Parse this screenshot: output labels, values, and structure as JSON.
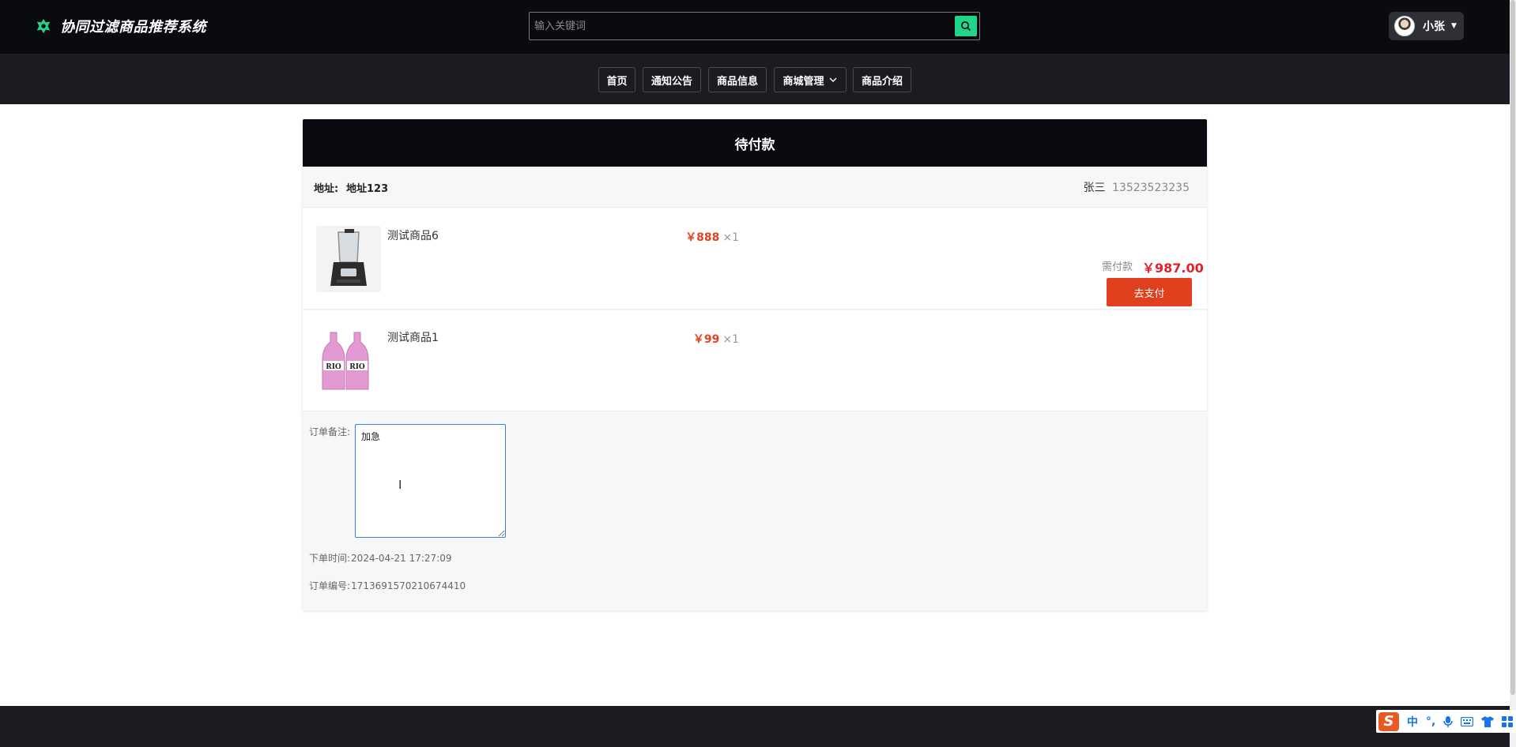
{
  "header": {
    "app_title": "协同过滤商品推荐系统",
    "search_placeholder": "输入关键词",
    "user_name": "小张"
  },
  "nav": {
    "items": [
      {
        "label": "首页"
      },
      {
        "label": "通知公告"
      },
      {
        "label": "商品信息"
      },
      {
        "label": "商城管理"
      },
      {
        "label": "商品介绍"
      }
    ]
  },
  "order": {
    "status_title": "待付款",
    "address_label": "地址:",
    "address": "地址123",
    "recipient": "张三",
    "phone": "13523523235",
    "items": [
      {
        "name": "测试商品6",
        "price": "￥888",
        "qty": "×1"
      },
      {
        "name": "测试商品1",
        "price": "￥99",
        "qty": "×1"
      }
    ],
    "due_label": "需付款",
    "due_amount": "￥987.00",
    "pay_button": "去支付",
    "note_label": "订单备注:",
    "note_value": "加急",
    "order_time_label": "下单时间:",
    "order_time": "2024-04-21 17:27:09",
    "order_no_label": "订单编号:",
    "order_no": "1713691570210674410"
  },
  "ime": {
    "logo": "S",
    "mode": "中",
    "punct": "°,"
  },
  "colors": {
    "accent_green": "#20d489",
    "price_red": "#e04420",
    "pay_button": "#e0401e",
    "header_bg": "#0a0b0f"
  }
}
